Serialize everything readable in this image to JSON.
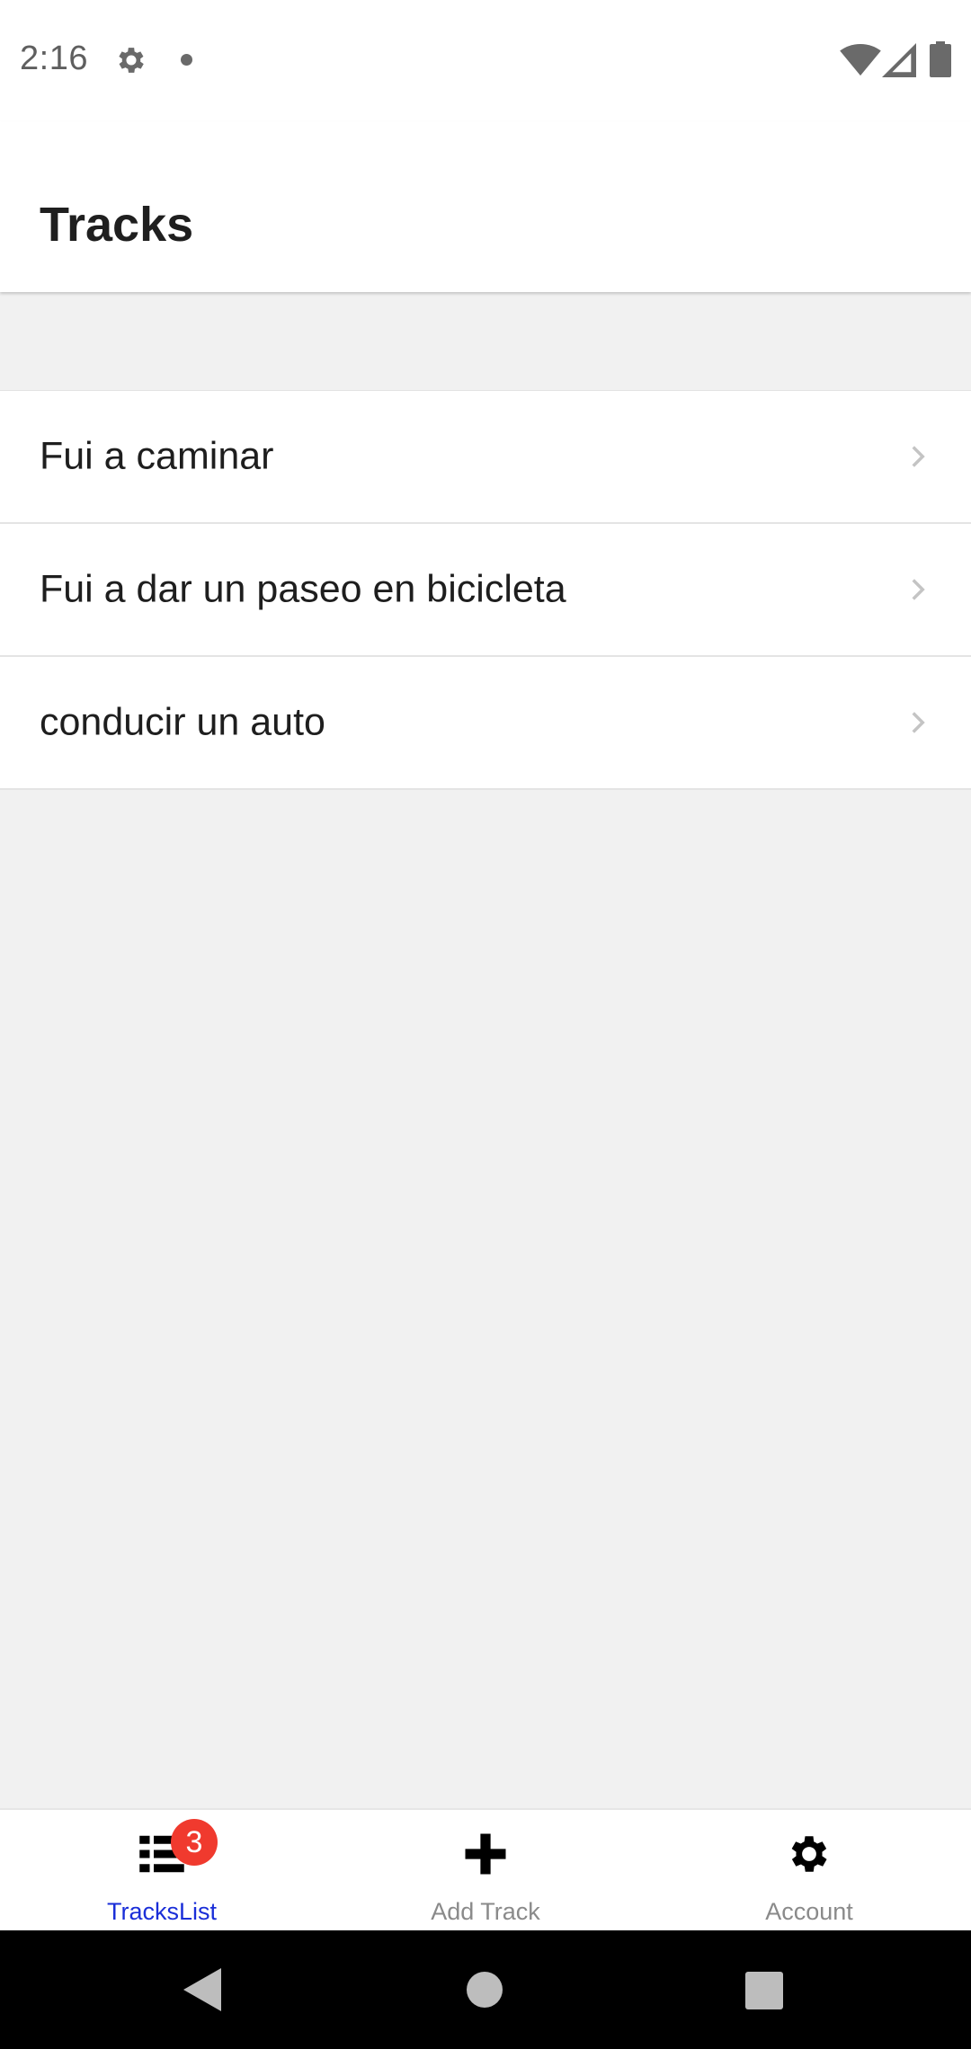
{
  "status_bar": {
    "time": "2:16",
    "icons": [
      "settings-icon",
      "notification-dot",
      "wifi-icon",
      "signal-icon",
      "battery-icon"
    ]
  },
  "header": {
    "title": "Tracks"
  },
  "tracks": [
    {
      "name": "Fui a caminar"
    },
    {
      "name": "Fui a dar un paseo en bicicleta"
    },
    {
      "name": "conducir un auto"
    }
  ],
  "tab_bar": {
    "tabs": [
      {
        "label": "TracksList",
        "icon": "list-icon",
        "badge": "3",
        "active": true
      },
      {
        "label": "Add Track",
        "icon": "plus-icon",
        "active": false
      },
      {
        "label": "Account",
        "icon": "gear-icon",
        "active": false
      }
    ]
  },
  "colors": {
    "active_tab": "#1a2ed8",
    "badge": "#f03a2e",
    "background": "#f1f1f1"
  }
}
